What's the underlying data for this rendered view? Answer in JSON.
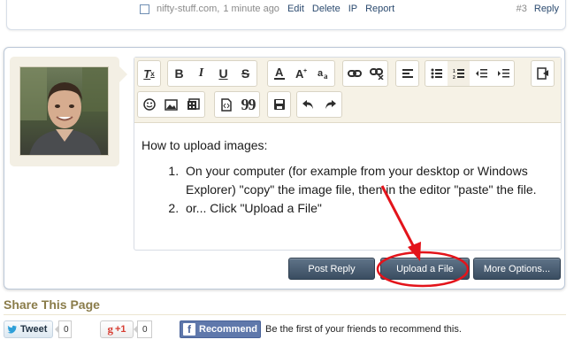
{
  "previous_post": {
    "author": "nifty-stuff.com,",
    "time": "1 minute ago",
    "controls": [
      "Edit",
      "Delete",
      "IP",
      "Report"
    ],
    "post_number": "#3",
    "reply_label": "Reply"
  },
  "toolbar": {
    "row1": [
      "remove-format",
      "bold",
      "italic",
      "underline",
      "strikethrough",
      "font-color",
      "font-size",
      "font-family",
      "link",
      "unlink",
      "align",
      "bulleted-list",
      "numbered-list",
      "outdent",
      "indent",
      "switch-mode"
    ],
    "row2": [
      "smilies",
      "image",
      "media",
      "code",
      "quote",
      "save-draft",
      "undo",
      "redo"
    ],
    "labels": {
      "italic": "I",
      "bold": "B",
      "underline": "U",
      "strikethrough": "S",
      "quote": "99"
    }
  },
  "editor": {
    "intro": "How to upload images:",
    "steps": [
      "On your computer (for example from your desktop or Windows Explorer) \"copy\" the image file, then in the editor \"paste\" the file.",
      "or... Click \"Upload a File\""
    ]
  },
  "buttons": {
    "post_reply": "Post Reply",
    "upload_file": "Upload a File",
    "more_options": "More Options..."
  },
  "annotation_color": "#e3141b",
  "share": {
    "title": "Share This Page",
    "tweet_label": "Tweet",
    "tweet_count": "0",
    "gplus_label": "+1",
    "gplus_count": "0",
    "fb_label": "Recommend",
    "fb_text": "Be the first of your friends to recommend this."
  }
}
